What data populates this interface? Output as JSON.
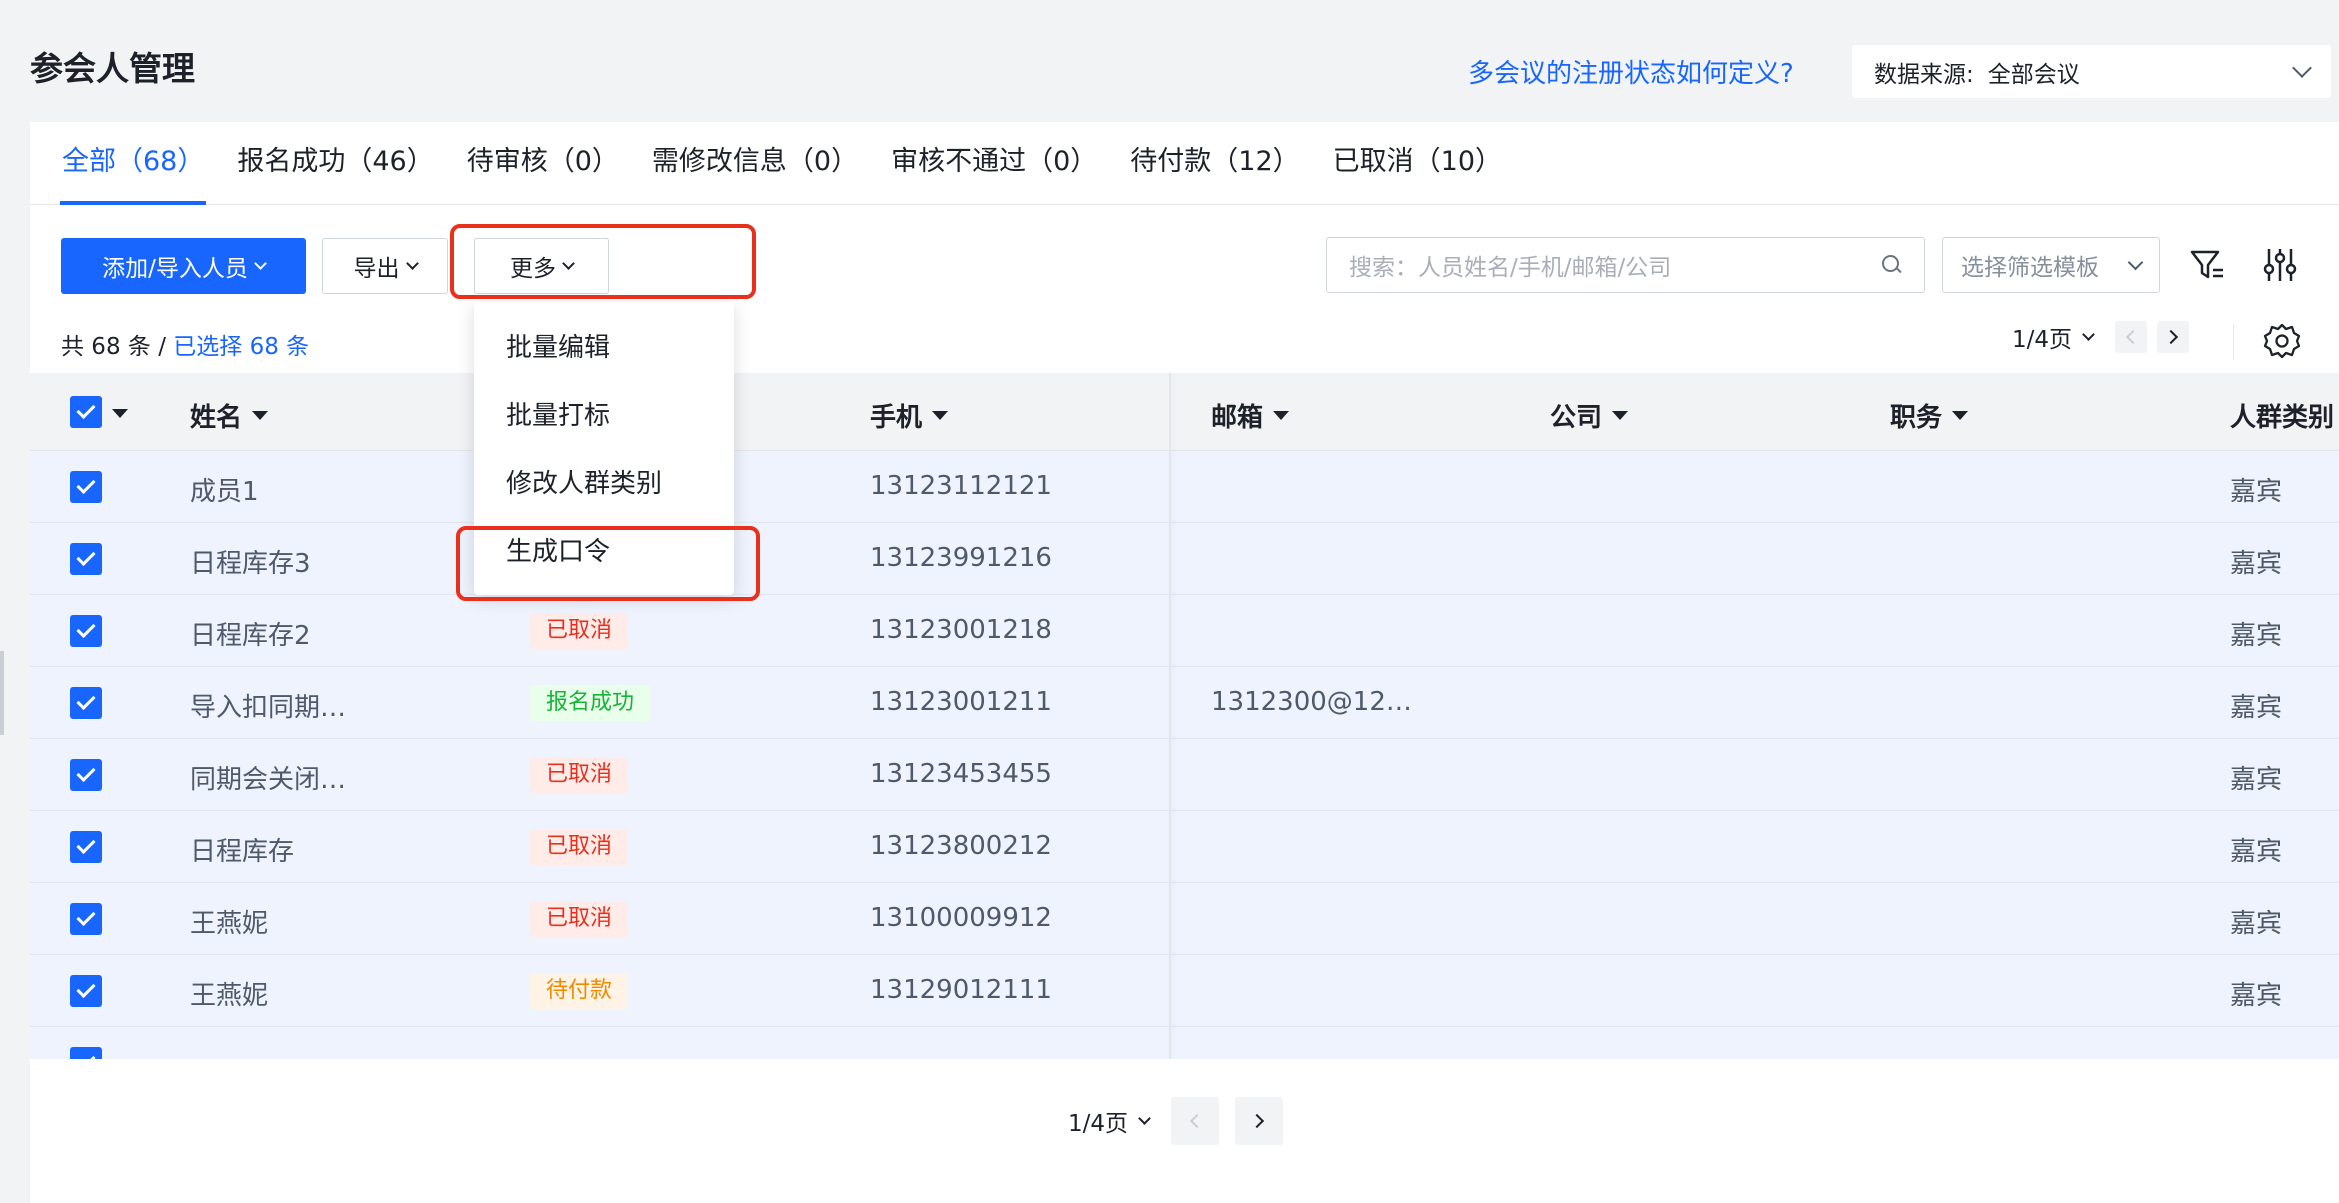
{
  "header": {
    "title": "参会人管理",
    "help_link": "多会议的注册状态如何定义?",
    "source_label": "数据来源:",
    "source_value": "全部会议"
  },
  "tabs": [
    {
      "label": "全部（68）",
      "active": true
    },
    {
      "label": "报名成功（46）"
    },
    {
      "label": "待审核（0）"
    },
    {
      "label": "需修改信息（0）"
    },
    {
      "label": "审核不通过（0）"
    },
    {
      "label": "待付款（12）"
    },
    {
      "label": "已取消（10）"
    }
  ],
  "toolbar": {
    "add_label": "添加/导入人员",
    "export_label": "导出",
    "more_label": "更多",
    "search_placeholder": "搜索：人员姓名/手机/邮箱/公司",
    "filter_template": "选择筛选模板"
  },
  "more_menu": {
    "items": [
      "批量编辑",
      "批量打标",
      "修改人群类别",
      "生成口令"
    ]
  },
  "summary": {
    "total": "共 68 条 /",
    "selected": "已选择 68 条"
  },
  "pager": {
    "page": "1/4页"
  },
  "table": {
    "columns": [
      "姓名",
      "手机",
      "邮箱",
      "公司",
      "职务",
      "人群类别"
    ],
    "rows": [
      {
        "name": "成员1",
        "status": "",
        "status_type": "",
        "phone": "13123112121",
        "email": "",
        "group": "嘉宾"
      },
      {
        "name": "日程库存3",
        "status": "",
        "status_type": "",
        "phone": "13123991216",
        "email": "",
        "group": "嘉宾"
      },
      {
        "name": "日程库存2",
        "status": "已取消",
        "status_type": "cancel",
        "phone": "13123001218",
        "email": "",
        "group": "嘉宾"
      },
      {
        "name": "导入扣同期…",
        "status": "报名成功",
        "status_type": "ok",
        "phone": "13123001211",
        "email": "1312300@12…",
        "group": "嘉宾"
      },
      {
        "name": "同期会关闭…",
        "status": "已取消",
        "status_type": "cancel",
        "phone": "13123453455",
        "email": "",
        "group": "嘉宾"
      },
      {
        "name": "日程库存",
        "status": "已取消",
        "status_type": "cancel",
        "phone": "13123800212",
        "email": "",
        "group": "嘉宾"
      },
      {
        "name": "王燕妮",
        "status": "已取消",
        "status_type": "cancel",
        "phone": "13100009912",
        "email": "",
        "group": "嘉宾"
      },
      {
        "name": "王燕妮",
        "status": "待付款",
        "status_type": "pay",
        "phone": "13129012111",
        "email": "",
        "group": "嘉宾"
      }
    ]
  },
  "colors": {
    "primary": "#1966ff",
    "highlight": "#e8301c",
    "row_selected_bg": "#eef3fd"
  }
}
